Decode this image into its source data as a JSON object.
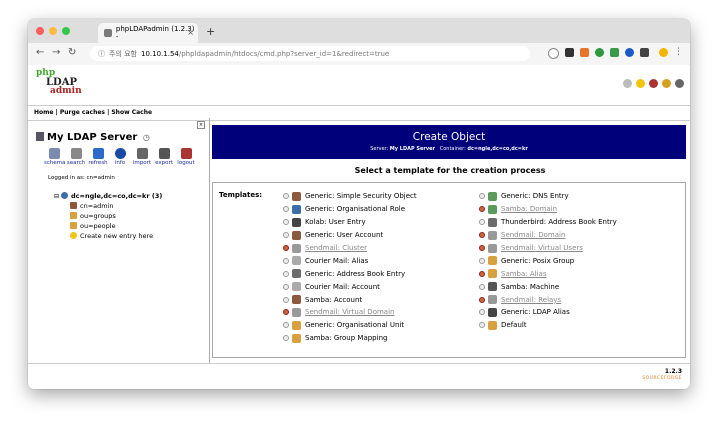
{
  "browser": {
    "tab_title": "phpLDAPadmin (1.2.3) -",
    "new_tab": "+",
    "security": "주의 요함",
    "url_host": "10.10.1.54",
    "url_path": "/phpldapadmin/htdocs/cmd.php?server_id=1&redirect=true"
  },
  "logo": {
    "line1": "php",
    "line2": "LDAP",
    "line3": "admin"
  },
  "menu": {
    "text": "Home | Purge caches | Show Cache"
  },
  "sidebar": {
    "server_name": "My LDAP Server",
    "tools": [
      "schema",
      "search",
      "refresh",
      "info",
      "import",
      "export",
      "logout"
    ],
    "logged_in": "Logged in as: cn=admin",
    "tree": [
      "dc=ngle,dc=co,dc=kr (3)",
      "cn=admin",
      "ou=groups",
      "ou=people",
      "Create new entry here"
    ]
  },
  "main": {
    "title": "Create Object",
    "server_label": "Server:",
    "server_value": "My LDAP Server",
    "container_label": "Container:",
    "container_value": "dc=ngle,dc=co,dc=kr",
    "prompt": "Select a template for the creation process",
    "templates_label": "Templates:",
    "left_templates": [
      {
        "label": "Generic: Simple Security Object",
        "disabled": false,
        "icon": "#8a5a3a"
      },
      {
        "label": "Generic: Organisational Role",
        "disabled": false,
        "icon": "#3a6ea8"
      },
      {
        "label": "Kolab: User Entry",
        "disabled": false,
        "icon": "#444"
      },
      {
        "label": "Generic: User Account",
        "disabled": false,
        "icon": "#8a5a3a"
      },
      {
        "label": "Sendmail: Cluster",
        "disabled": true,
        "icon": "#999"
      },
      {
        "label": "Courier Mail: Alias",
        "disabled": false,
        "icon": "#aaa"
      },
      {
        "label": "Generic: Address Book Entry",
        "disabled": false,
        "icon": "#6b6b6b"
      },
      {
        "label": "Courier Mail: Account",
        "disabled": false,
        "icon": "#aaa"
      },
      {
        "label": "Samba: Account",
        "disabled": false,
        "icon": "#8a5a3a"
      },
      {
        "label": "Sendmail: Virtual Domain",
        "disabled": true,
        "icon": "#999"
      },
      {
        "label": "Generic: Organisational Unit",
        "disabled": false,
        "icon": "#d9a040"
      },
      {
        "label": "Samba: Group Mapping",
        "disabled": false,
        "icon": "#d9a040"
      }
    ],
    "right_templates": [
      {
        "label": "Generic: DNS Entry",
        "disabled": false,
        "icon": "#5a9a5a"
      },
      {
        "label": "Samba: Domain",
        "disabled": true,
        "icon": "#5a9a5a"
      },
      {
        "label": "Thunderbird: Address Book Entry",
        "disabled": false,
        "icon": "#6b6b6b"
      },
      {
        "label": "Sendmail: Domain",
        "disabled": true,
        "icon": "#999"
      },
      {
        "label": "Sendmail: Virtual Users",
        "disabled": true,
        "icon": "#999"
      },
      {
        "label": "Generic: Posix Group",
        "disabled": false,
        "icon": "#d9a040"
      },
      {
        "label": "Samba: Alias",
        "disabled": true,
        "icon": "#d9a040"
      },
      {
        "label": "Samba: Machine",
        "disabled": false,
        "icon": "#555"
      },
      {
        "label": "Sendmail: Relays",
        "disabled": true,
        "icon": "#999"
      },
      {
        "label": "Generic: LDAP Alias",
        "disabled": false,
        "icon": "#444"
      },
      {
        "label": "Default",
        "disabled": false,
        "icon": "#d9a040"
      }
    ]
  },
  "footer": {
    "version": "1.2.3",
    "sf": "SOURCEFORGE"
  },
  "colors": {
    "header_blue": "#00007a",
    "link_blue": "#1b2ca0"
  }
}
